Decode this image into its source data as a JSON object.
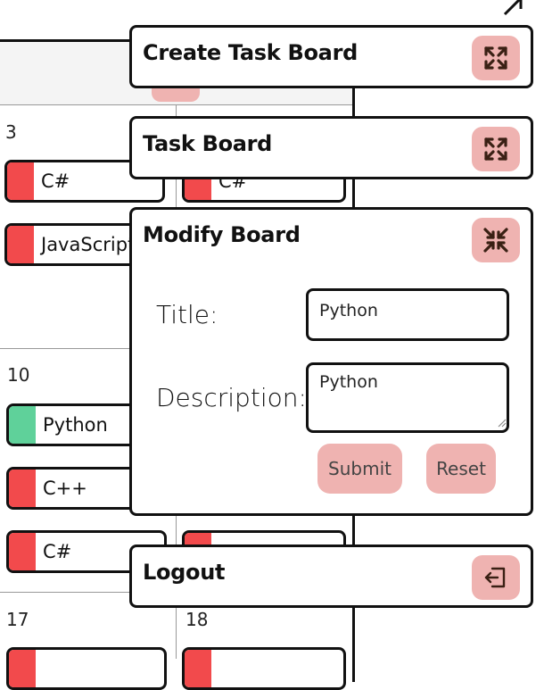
{
  "calendar": {
    "days": [
      "3",
      "10",
      "17",
      "18"
    ],
    "week1": [
      {
        "label": "C#",
        "color": "#f24a4c"
      },
      {
        "label": "JavaScript",
        "color": "#f24a4c"
      },
      {
        "label": "C#",
        "color": "#f24a4c"
      }
    ],
    "week2": [
      {
        "label": "Python",
        "color": "#5fd19a"
      },
      {
        "label": "C++",
        "color": "#f24a4c"
      },
      {
        "label": "C#",
        "color": "#f24a4c"
      }
    ]
  },
  "panels": {
    "create": {
      "title": "Create Task Board",
      "icon": "expand-icon"
    },
    "board": {
      "title": "Task Board",
      "icon": "expand-icon"
    },
    "modify": {
      "title": "Modify Board",
      "icon": "collapse-icon",
      "title_label": "Title:",
      "title_value": "Python",
      "description_label": "Description:",
      "description_value": "Python",
      "submit_label": "Submit",
      "reset_label": "Reset"
    },
    "logout": {
      "title": "Logout",
      "icon": "logout-icon"
    }
  },
  "colors": {
    "accent": "#efb3b1",
    "red": "#f24a4c",
    "green": "#5fd19a"
  }
}
